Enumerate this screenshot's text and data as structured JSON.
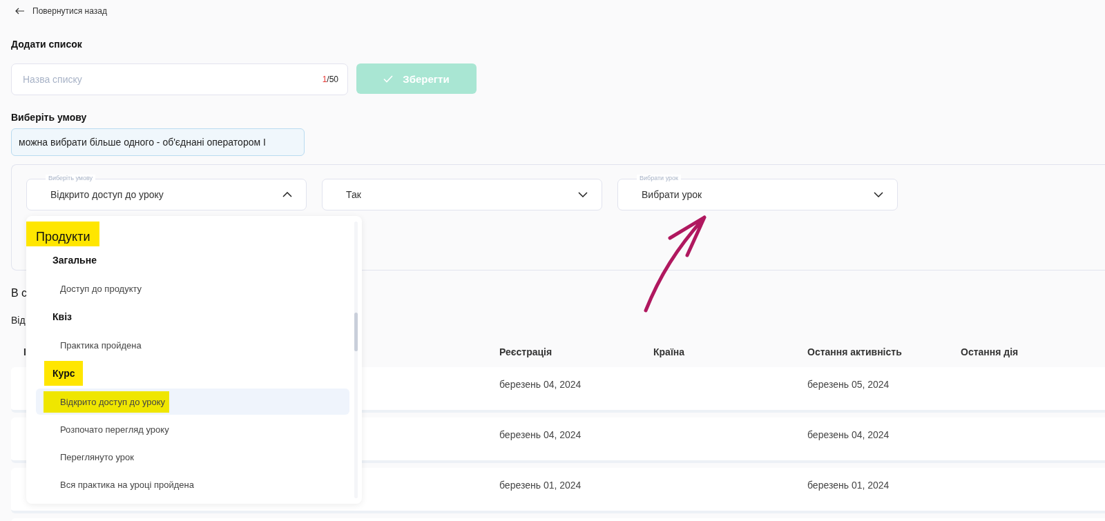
{
  "back_link": {
    "label": "Повернутися назад"
  },
  "add_list": {
    "title": "Додати список",
    "name_field": {
      "placeholder": "Назва списку",
      "count_current": "1",
      "count_max": "/50"
    },
    "save_button": {
      "label": "Зберегти",
      "disabled": true
    }
  },
  "condition": {
    "title": "Виберіть умову",
    "hint": "можна вибрати більше одного - об'єднані оператором І"
  },
  "filters": [
    {
      "label": "Виберіть умову",
      "value": "Відкрито доступ до уроку",
      "expanded": true
    },
    {
      "value": "Так",
      "expanded": false
    },
    {
      "label": "Вибрати урок",
      "value": "Вибрати урок",
      "expanded": false
    }
  ],
  "dropdown": {
    "title": "Продукти",
    "title_highlighted": true,
    "groups": [
      {
        "label": "Загальне",
        "highlighted": false,
        "items": [
          {
            "label": "Доступ до продукту",
            "selected": false,
            "highlighted": false
          }
        ]
      },
      {
        "label": "Квіз",
        "highlighted": false,
        "items": [
          {
            "label": "Практика пройдена",
            "selected": false,
            "highlighted": false
          }
        ]
      },
      {
        "label": "Курс",
        "highlighted": true,
        "items": [
          {
            "label": "Відкрито доступ до уроку",
            "selected": true,
            "highlighted": true
          },
          {
            "label": "Розпочато перегляд уроку",
            "selected": false,
            "highlighted": false
          },
          {
            "label": "Переглянуто урок",
            "selected": false,
            "highlighted": false
          },
          {
            "label": "Вся практика на уроці пройдена",
            "selected": false,
            "highlighted": false
          }
        ]
      }
    ]
  },
  "section": {
    "title": "В с",
    "subtitle": "Від"
  },
  "table": {
    "columns": [
      "І",
      "Реєстрація",
      "Країна",
      "Остання активність",
      "Остання дія"
    ],
    "rows": [
      [
        "",
        "березень 04, 2024",
        "",
        "березень 05, 2024",
        ""
      ],
      [
        "",
        "березень 04, 2024",
        "",
        "березень 04, 2024",
        ""
      ],
      [
        "",
        "березень 01, 2024",
        "",
        "березень 01, 2024",
        ""
      ]
    ]
  }
}
